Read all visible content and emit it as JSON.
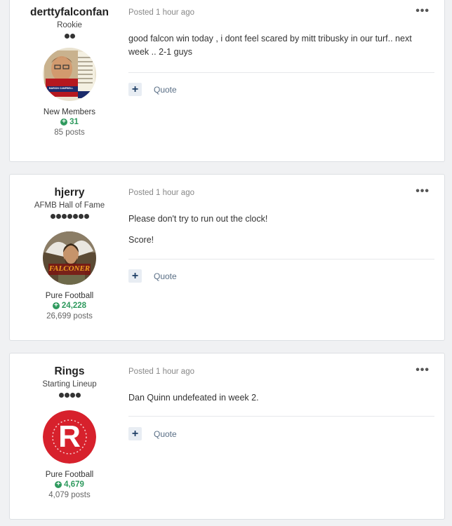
{
  "posts": [
    {
      "author": "derttyfalconfan",
      "rank": "Rookie",
      "pips": 2,
      "group": "New Members",
      "reputation": "31",
      "post_count": "85 posts",
      "posted": "Posted 1 hour ago",
      "paragraphs": [
        "good falcon win today   , i dont feel  scared by mitt tribusky  in our  turf.. next week   .. 2-1   guys"
      ],
      "quote_label": "Quote",
      "avatar_caption": "MARION CAMPBELL"
    },
    {
      "author": "hjerry",
      "rank": "AFMB Hall of Fame",
      "pips": 7,
      "group": "Pure Football",
      "reputation": "24,228",
      "post_count": "26,699 posts",
      "posted": "Posted 1 hour ago",
      "paragraphs": [
        "Please don't try to run out the clock!",
        "Score!"
      ],
      "quote_label": "Quote",
      "avatar_caption": "FALCONER"
    },
    {
      "author": "Rings",
      "rank": "Starting Lineup",
      "pips": 4,
      "group": "Pure Football",
      "reputation": "4,679",
      "post_count": "4,079 posts",
      "posted": "Posted 1 hour ago",
      "paragraphs": [
        "Dan Quinn undefeated in week 2."
      ],
      "quote_label": "Quote",
      "avatar_caption": "R"
    }
  ],
  "icons": {
    "reputation": "plus-circle-icon",
    "more": "ellipsis-icon",
    "multiquote": "plus-icon"
  },
  "colors": {
    "reputation": "#2f9a5e",
    "rings_avatar": "#d7212c"
  }
}
